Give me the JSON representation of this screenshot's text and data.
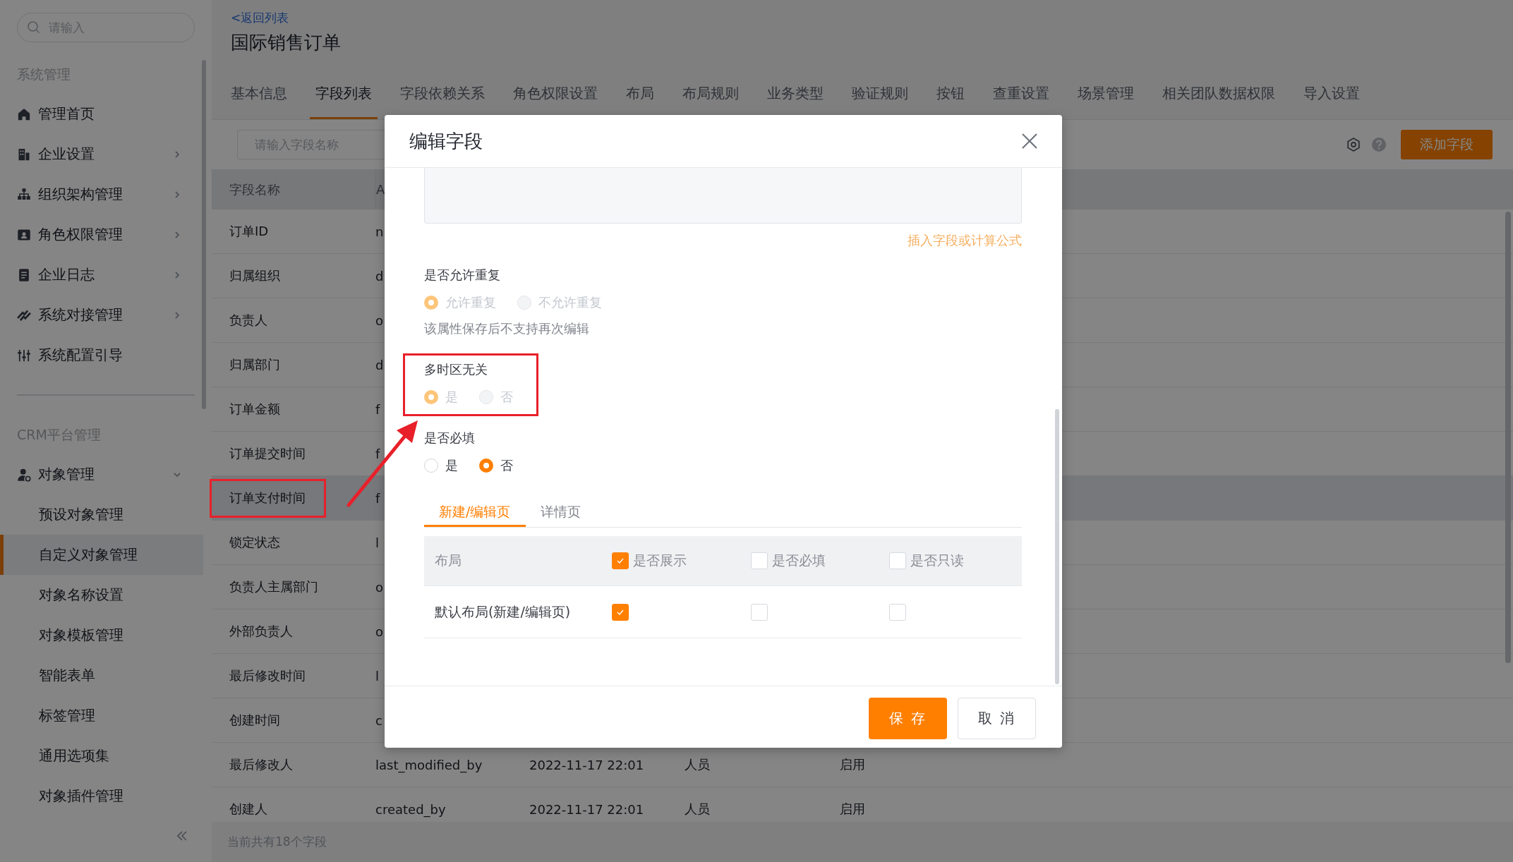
{
  "sidebar": {
    "search": {
      "placeholder": "请输入"
    },
    "sections": [
      {
        "title": "系统管理",
        "items": [
          {
            "label": "管理首页",
            "expandable": false
          },
          {
            "label": "企业设置",
            "expandable": true,
            "expanded": false
          },
          {
            "label": "组织架构管理",
            "expandable": true,
            "expanded": false
          },
          {
            "label": "角色权限管理",
            "expandable": true,
            "expanded": false
          },
          {
            "label": "企业日志",
            "expandable": true,
            "expanded": false
          },
          {
            "label": "系统对接管理",
            "expandable": true,
            "expanded": false
          },
          {
            "label": "系统配置引导",
            "expandable": false
          }
        ]
      },
      {
        "title": "CRM平台管理",
        "items": [
          {
            "label": "对象管理",
            "expandable": true,
            "expanded": true,
            "children": [
              {
                "label": "预设对象管理",
                "selected": false
              },
              {
                "label": "自定义对象管理",
                "selected": true
              },
              {
                "label": "对象名称设置",
                "selected": false
              },
              {
                "label": "对象模板管理",
                "selected": false
              },
              {
                "label": "智能表单",
                "selected": false
              },
              {
                "label": "标签管理",
                "selected": false
              },
              {
                "label": "通用选项集",
                "selected": false
              },
              {
                "label": "对象插件管理",
                "selected": false
              }
            ]
          }
        ]
      }
    ]
  },
  "header": {
    "back_link": "<返回列表",
    "title": "国际销售订单"
  },
  "tabs": [
    {
      "label": "基本信息",
      "selected": false
    },
    {
      "label": "字段列表",
      "selected": true
    },
    {
      "label": "字段依赖关系",
      "selected": false
    },
    {
      "label": "角色权限设置",
      "selected": false
    },
    {
      "label": "布局",
      "selected": false
    },
    {
      "label": "布局规则",
      "selected": false
    },
    {
      "label": "业务类型",
      "selected": false
    },
    {
      "label": "验证规则",
      "selected": false
    },
    {
      "label": "按钮",
      "selected": false
    },
    {
      "label": "查重设置",
      "selected": false
    },
    {
      "label": "场景管理",
      "selected": false
    },
    {
      "label": "相关团队数据权限",
      "selected": false
    },
    {
      "label": "导入设置",
      "selected": false
    }
  ],
  "toolbar": {
    "search": {
      "placeholder": "请输入字段名称"
    },
    "add_button": "添加字段"
  },
  "table": {
    "columns": [
      "字段名称",
      "A"
    ],
    "rows": [
      {
        "cells": [
          "订单ID",
          "n"
        ],
        "selected": false,
        "highlighted": false
      },
      {
        "cells": [
          "归属组织",
          "d"
        ],
        "selected": false,
        "highlighted": false
      },
      {
        "cells": [
          "负责人",
          "o"
        ],
        "selected": false,
        "highlighted": false
      },
      {
        "cells": [
          "归属部门",
          "d"
        ],
        "selected": false,
        "highlighted": false
      },
      {
        "cells": [
          "订单金额",
          "f"
        ],
        "selected": false,
        "highlighted": false
      },
      {
        "cells": [
          "订单提交时间",
          "f"
        ],
        "selected": false,
        "highlighted": false
      },
      {
        "cells": [
          "订单支付时间",
          "f"
        ],
        "selected": true,
        "highlighted": true
      },
      {
        "cells": [
          "锁定状态",
          "l"
        ],
        "selected": false,
        "highlighted": false
      },
      {
        "cells": [
          "负责人主属部门",
          "o"
        ],
        "selected": false,
        "highlighted": false
      },
      {
        "cells": [
          "外部负责人",
          "o"
        ],
        "selected": false,
        "highlighted": false
      },
      {
        "cells": [
          "最后修改时间",
          "l"
        ],
        "selected": false,
        "highlighted": false
      },
      {
        "cells": [
          "创建时间",
          "c"
        ],
        "selected": false,
        "highlighted": false
      },
      {
        "cells": [
          "最后修改人",
          "last_modified_by",
          "2022-11-17 22:01",
          "人员",
          "启用"
        ],
        "selected": false,
        "highlighted": false
      },
      {
        "cells": [
          "创建人",
          "created_by",
          "2022-11-17 22:01",
          "人员",
          "启用"
        ],
        "selected": false,
        "highlighted": false
      }
    ]
  },
  "footer": "当前共有18个字段",
  "modal": {
    "title": "编辑字段",
    "link": "插入字段或计算公式",
    "fields": [
      {
        "label": "是否允许重复",
        "disabled": true,
        "highlighted": false,
        "options": [
          {
            "label": "允许重复",
            "selected": true
          },
          {
            "label": "不允许重复",
            "selected": false
          }
        ],
        "note": "该属性保存后不支持再次编辑"
      },
      {
        "label": "多时区无关",
        "disabled": true,
        "highlighted": true,
        "options": [
          {
            "label": "是",
            "selected": true
          },
          {
            "label": "否",
            "selected": false
          }
        ]
      },
      {
        "label": "是否必填",
        "disabled": false,
        "highlighted": false,
        "options": [
          {
            "label": "是",
            "selected": false
          },
          {
            "label": "否",
            "selected": true
          }
        ]
      }
    ],
    "tabs": [
      {
        "label": "新建/编辑页",
        "selected": true
      },
      {
        "label": "详情页",
        "selected": false
      }
    ],
    "layout_table": {
      "columns": [
        {
          "kind": "text",
          "label": "布局"
        },
        {
          "kind": "checkbox",
          "label": "是否展示",
          "checked": true
        },
        {
          "kind": "checkbox",
          "label": "是否必填",
          "checked": false
        },
        {
          "kind": "checkbox",
          "label": "是否只读",
          "checked": false
        }
      ],
      "rows": [
        {
          "label": "默认布局(新建/编辑页)",
          "checks": [
            {
              "checked": true
            },
            {
              "checked": false
            },
            {
              "checked": false
            }
          ]
        }
      ]
    },
    "buttons": [
      {
        "label": "保 存",
        "kind": "primary"
      },
      {
        "label": "取 消",
        "kind": "default"
      }
    ]
  },
  "callout_arrow": true
}
